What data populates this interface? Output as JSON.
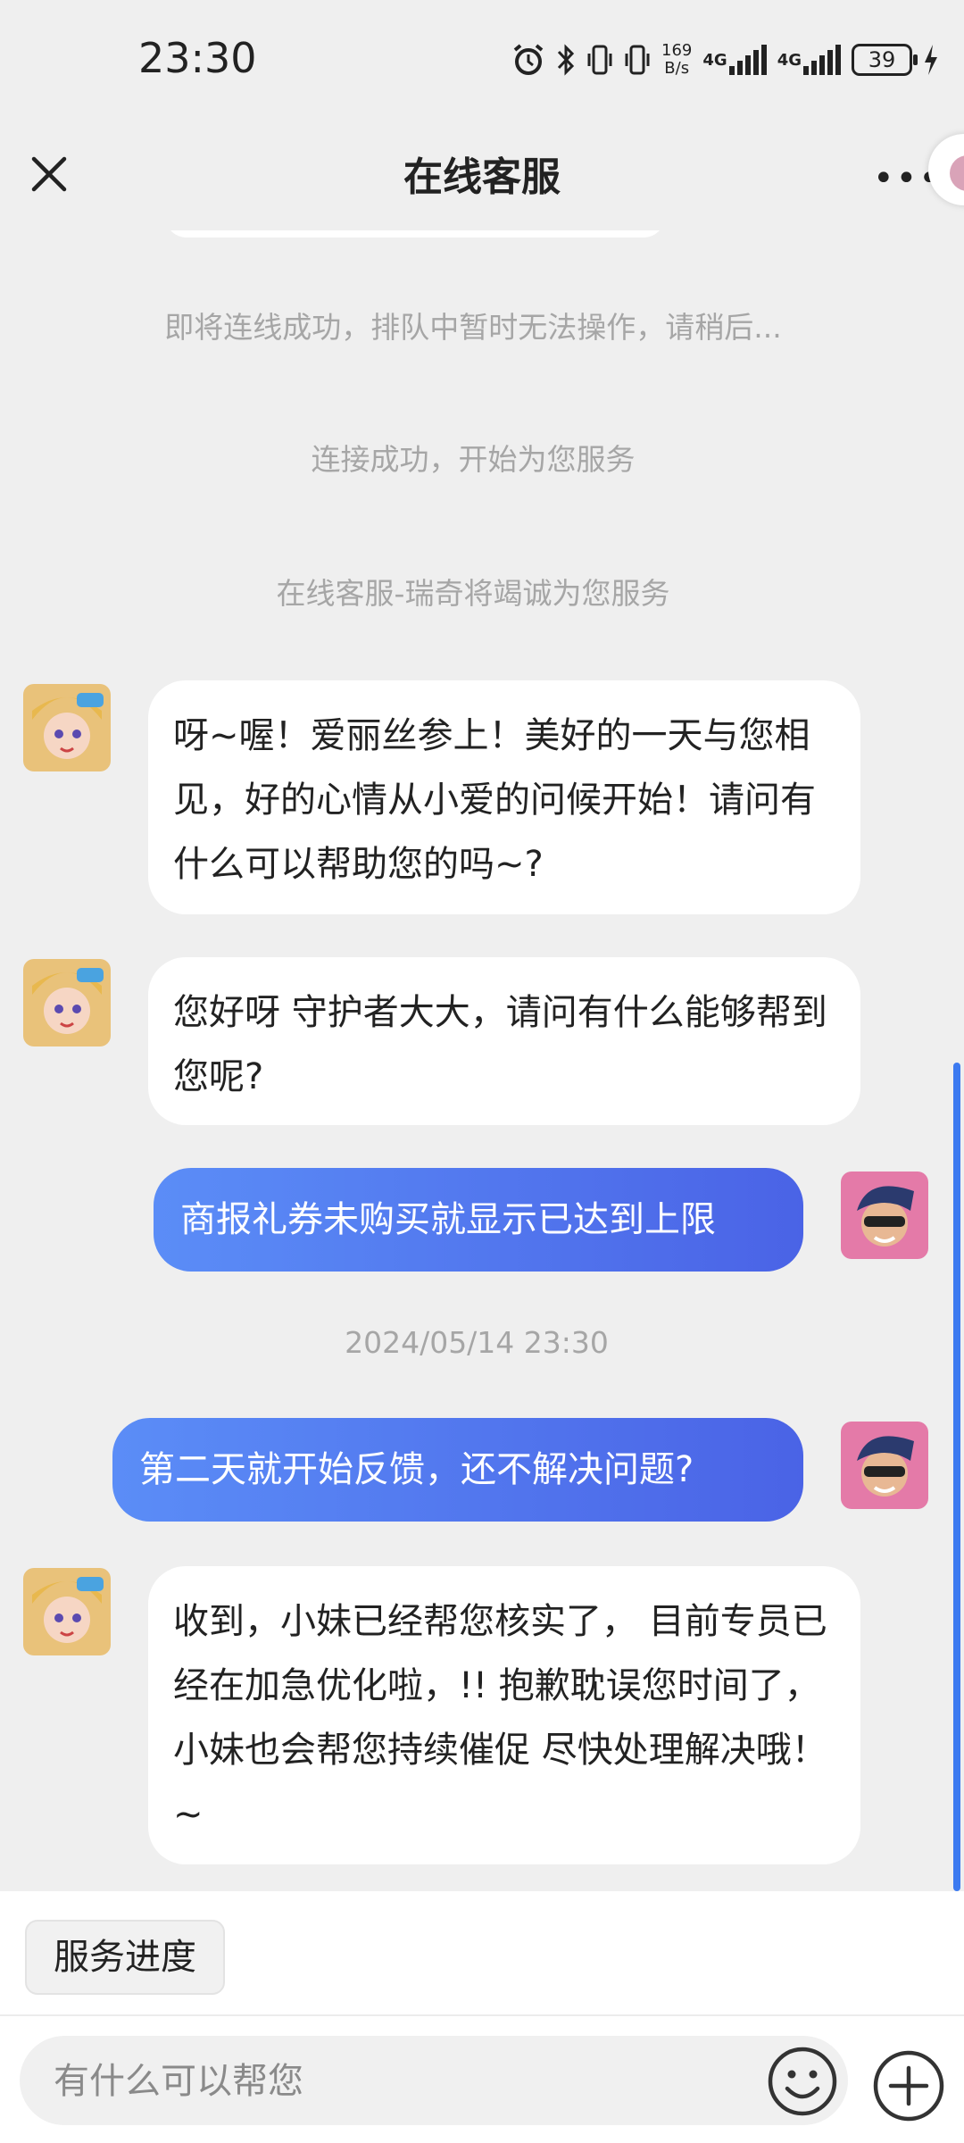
{
  "status_bar": {
    "time": "23:30",
    "net_speed_value": "169",
    "net_speed_unit": "B/s",
    "signal1_label": "4G",
    "signal2_label": "4G",
    "battery": "39",
    "icons": [
      "alarm-icon",
      "bluetooth-icon",
      "vibrate-icon",
      "vibrate-icon",
      "net-speed",
      "signal-icon",
      "signal-icon",
      "battery-icon",
      "charging-icon"
    ]
  },
  "header": {
    "title": "在线客服"
  },
  "chat": {
    "system_messages": [
      "即将连线成功，排队中暂时无法操作，请稍后...",
      "连接成功，开始为您服务",
      "在线客服-瑞奇将竭诚为您服务"
    ],
    "timestamp": "2024/05/14 23:30",
    "messages": [
      {
        "from": "agent",
        "text": "呀~喔！爱丽丝参上！美好的一天与您相见，好的心情从小爱的问候开始！请问有什么可以帮助您的吗~?"
      },
      {
        "from": "agent",
        "text": "您好呀 守护者大大，请问有什么能够帮到您呢?"
      },
      {
        "from": "user",
        "text": "商报礼券未购买就显示已达到上限"
      },
      {
        "from": "user",
        "text": "第二天就开始反馈，还不解决问题?"
      },
      {
        "from": "agent",
        "text": "收到，小妹已经帮您核实了， 目前专员已经在加急优化啦，!! 抱歉耽误您时间了， 小妹也会帮您持续催促 尽快处理解决哦！ ~"
      }
    ]
  },
  "quick_actions": {
    "service_progress": "服务进度"
  },
  "input": {
    "placeholder": "有什么可以帮您"
  },
  "colors": {
    "background": "#efefef",
    "user_bubble_start": "#5b8df7",
    "user_bubble_end": "#4a63e6",
    "scrollbar": "#3c7af0"
  }
}
